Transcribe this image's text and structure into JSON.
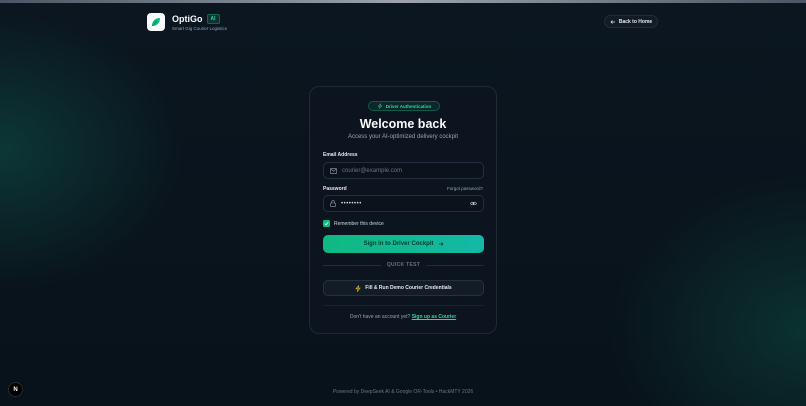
{
  "brand": {
    "name": "OptiGo",
    "badge": "AI",
    "tagline": "Smart Gig Courier Logistics"
  },
  "header": {
    "back_label": "Back to Home"
  },
  "card": {
    "pill_label": "Driver Authentication",
    "title": "Welcome back",
    "subtitle": "Access your AI-optimized delivery cockpit",
    "email": {
      "label": "Email Address",
      "placeholder": "courier@example.com"
    },
    "password": {
      "label": "Password",
      "forgot_label": "Forgot password?",
      "value": "••••••••"
    },
    "remember_label": "Remember this device",
    "signin_label": "Sign in to Driver Cockpit",
    "quick_test_label": "QUICK TEST",
    "demo_label": "Fill & Run Demo Courier Credentials",
    "signup_prompt": "Don't have an account yet?",
    "signup_link": "Sign up as Courier"
  },
  "footer": {
    "text": "Powered by DeepSeek AI & Google OR-Tools • HackMTY 2026"
  },
  "dev_badge": "N",
  "colors": {
    "accent": "#10b981",
    "accent_text": "#34d399",
    "background": "#071018",
    "card": "#0d1620"
  }
}
